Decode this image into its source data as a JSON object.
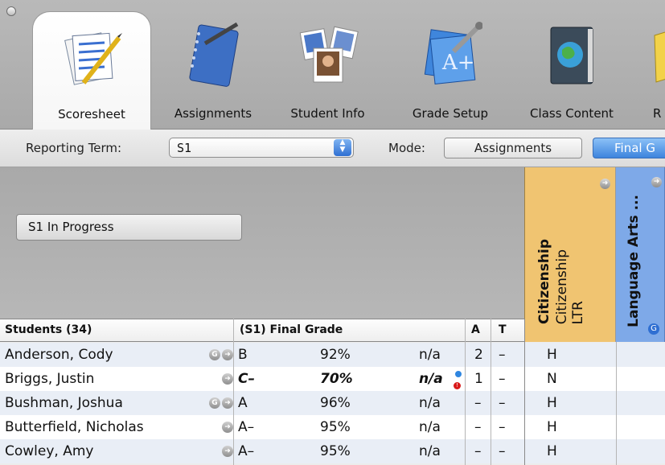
{
  "tabs": [
    {
      "label": "Scoresheet",
      "icon": "scoresheet-icon",
      "active": true
    },
    {
      "label": "Assignments",
      "icon": "notebook-icon",
      "active": false
    },
    {
      "label": "Student Info",
      "icon": "photos-icon",
      "active": false
    },
    {
      "label": "Grade Setup",
      "icon": "grade-setup-icon",
      "active": false
    },
    {
      "label": "Class Content",
      "icon": "globe-book-icon",
      "active": false
    },
    {
      "label": "R",
      "icon": "reports-icon",
      "active": false
    }
  ],
  "toolbar": {
    "reporting_term_label": "Reporting Term:",
    "reporting_term_value": "S1",
    "mode_label": "Mode:",
    "mode_assignments": "Assignments",
    "mode_final": "Final G"
  },
  "header": {
    "term_button": "S1 In Progress",
    "citizenship_title": "Citizenship",
    "citizenship_subtitle": "Citizenship",
    "citizenship_type": "LTR",
    "language_arts_title": "Language Arts ..."
  },
  "table": {
    "students_header": "Students (34)",
    "final_grade_header": "(S1) Final Grade",
    "a_header": "A",
    "t_header": "T",
    "rows": [
      {
        "name": "Anderson, Cody",
        "letter": "B",
        "percent": "92%",
        "na": "n/a",
        "a": "2",
        "t": "–",
        "cit": "H",
        "flagged": false
      },
      {
        "name": "Briggs, Justin",
        "letter": "C–",
        "percent": "70%",
        "na": "n/a",
        "a": "1",
        "t": "–",
        "cit": "N",
        "flagged": true
      },
      {
        "name": "Bushman, Joshua",
        "letter": "A",
        "percent": "96%",
        "na": "n/a",
        "a": "–",
        "t": "–",
        "cit": "H",
        "flagged": false
      },
      {
        "name": "Butterfield, Nicholas",
        "letter": "A–",
        "percent": "95%",
        "na": "n/a",
        "a": "–",
        "t": "–",
        "cit": "H",
        "flagged": false
      },
      {
        "name": "Cowley, Amy",
        "letter": "A–",
        "percent": "95%",
        "na": "n/a",
        "a": "–",
        "t": "–",
        "cit": "H",
        "flagged": false
      }
    ]
  },
  "colors": {
    "citizenship_column": "#f0c471",
    "language_arts_column": "#7ea9e8",
    "selected_mode": "#3d84dd",
    "row_alt": "#e9eef6"
  }
}
